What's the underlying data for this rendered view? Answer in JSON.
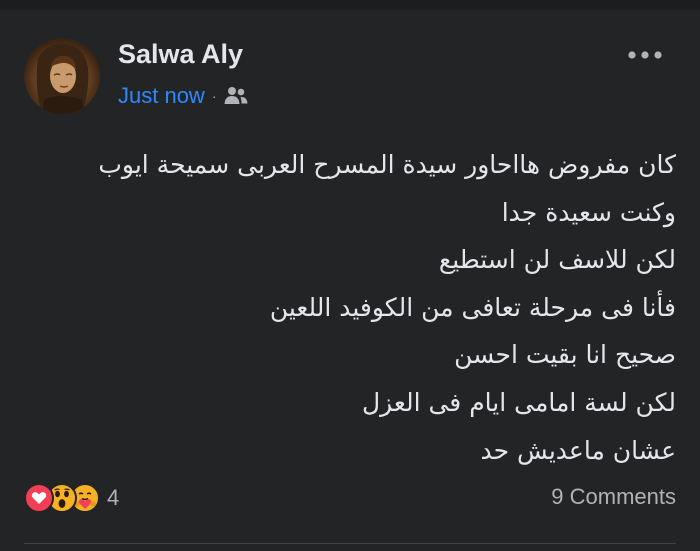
{
  "post": {
    "author": "Salwa Aly",
    "time": "Just now",
    "separator": "·",
    "audience_icon": "friends-icon",
    "more_icon": "more-horizontal-icon",
    "lines": [
      "كان مفروض هااحاور سيدة المسرح العربى سميحة ايوب",
      "وكنت سعيدة جدا",
      "لكن للاسف لن استطيع",
      "فأنا فى مرحلة تعافى من الكوفيد اللعين",
      "صحيح انا بقيت احسن",
      "لكن لسة امامى ايام فى العزل",
      "عشان ماعديش حد"
    ]
  },
  "footer": {
    "reactions": [
      {
        "icon": "love-reaction-icon",
        "color": "#f33e58"
      },
      {
        "icon": "wow-reaction-icon",
        "color": "#f7b125"
      },
      {
        "icon": "care-reaction-icon",
        "color": "#f7b125"
      }
    ],
    "reaction_count": "4",
    "comments": "9 Comments"
  },
  "colors": {
    "background": "#232425",
    "text": "#e4e6eb",
    "secondary_text": "#b0b3b8",
    "link": "#2d88ff"
  }
}
